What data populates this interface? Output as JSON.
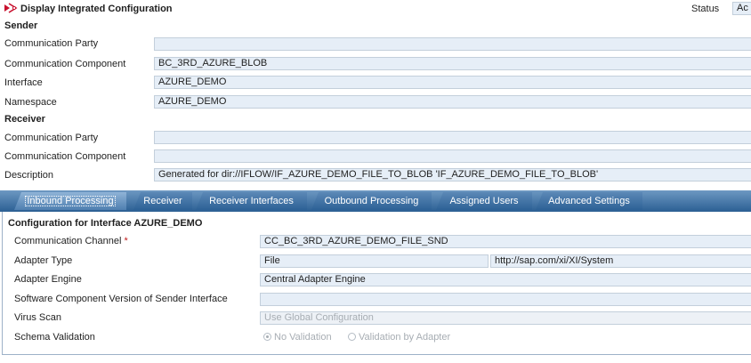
{
  "header": {
    "title": "Display Integrated Configuration",
    "status_label": "Status",
    "status_value": "Ac"
  },
  "sender": {
    "heading": "Sender",
    "rows": [
      {
        "label": "Communication Party",
        "value": ""
      },
      {
        "label": "Communication Component",
        "value": "BC_3RD_AZURE_BLOB"
      },
      {
        "label": "Interface",
        "value": "AZURE_DEMO"
      },
      {
        "label": "Namespace",
        "value": "AZURE_DEMO"
      }
    ]
  },
  "receiver": {
    "heading": "Receiver",
    "rows": [
      {
        "label": "Communication Party",
        "value": ""
      },
      {
        "label": "Communication Component",
        "value": ""
      },
      {
        "label": "Description",
        "value": "Generated for dir://IFLOW/IF_AZURE_DEMO_FILE_TO_BLOB 'IF_AZURE_DEMO_FILE_TO_BLOB'"
      }
    ]
  },
  "tabs": [
    {
      "label": "Inbound Processing",
      "active": true
    },
    {
      "label": "Receiver",
      "active": false
    },
    {
      "label": "Receiver Interfaces",
      "active": false
    },
    {
      "label": "Outbound Processing",
      "active": false
    },
    {
      "label": "Assigned Users",
      "active": false
    },
    {
      "label": "Advanced Settings",
      "active": false
    }
  ],
  "inbound": {
    "heading": "Configuration for Interface AZURE_DEMO",
    "channel_label": "Communication Channel",
    "required_mark": "*",
    "channel_value": "CC_BC_3RD_AZURE_DEMO_FILE_SND",
    "adapter_type_label": "Adapter Type",
    "adapter_type_value": "File",
    "adapter_namespace_value": "http://sap.com/xi/XI/System",
    "adapter_engine_label": "Adapter Engine",
    "adapter_engine_value": "Central Adapter Engine",
    "swcv_label": "Software Component Version of Sender Interface",
    "swcv_value": "",
    "virus_scan_label": "Virus Scan",
    "virus_scan_value": "Use Global Configuration",
    "schema_label": "Schema Validation",
    "schema_options": [
      {
        "label": "No Validation",
        "selected": true
      },
      {
        "label": "Validation by Adapter",
        "selected": false
      }
    ]
  },
  "colors": {
    "tab_bar": "#2b5f93",
    "field_bg": "#e6eef7",
    "accent_icon": "#c8102e"
  }
}
